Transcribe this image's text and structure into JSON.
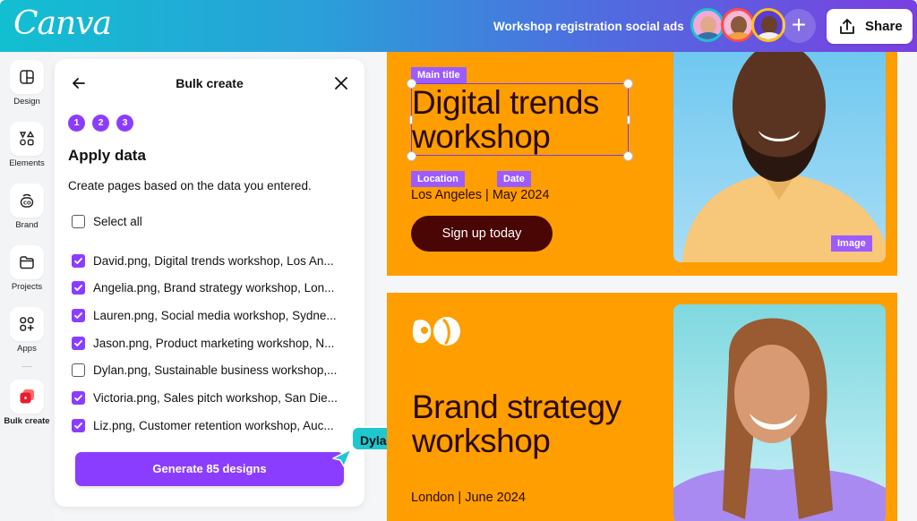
{
  "topbar": {
    "logo": "Canva",
    "doc_title": "Workshop registration social ads",
    "collaborators": [
      {
        "name": "collaborator-1",
        "ring": "#19c2d6",
        "bg": "#f3a9d8",
        "face": "#e1a88a",
        "body": "#3a6ea5"
      },
      {
        "name": "collaborator-2",
        "ring": "#ff4b4b",
        "bg": "#f7b9d5",
        "face": "#8a5a3c",
        "body": "#f0a040"
      },
      {
        "name": "collaborator-3",
        "ring": "#ffc21a",
        "bg": "#5b3bd6",
        "face": "#6a4128",
        "body": "#f4efe8"
      }
    ],
    "add_label": "+",
    "share_label": "Share"
  },
  "sidebar": {
    "items": [
      {
        "label": "Design",
        "icon": "layout-icon"
      },
      {
        "label": "Elements",
        "icon": "shapes-icon"
      },
      {
        "label": "Brand",
        "icon": "brand-icon"
      },
      {
        "label": "Projects",
        "icon": "folder-icon"
      },
      {
        "label": "Apps",
        "icon": "apps-icon"
      },
      {
        "label": "Bulk create",
        "icon": "bulk-create-icon"
      }
    ]
  },
  "panel": {
    "title": "Bulk create",
    "steps": [
      "1",
      "2",
      "3"
    ],
    "heading": "Apply data",
    "description": "Create pages based on the data you entered.",
    "select_all_label": "Select all",
    "select_all_checked": false,
    "rows": [
      {
        "label": "David.png, Digital trends workshop, Los An...",
        "checked": true
      },
      {
        "label": "Angelia.png, Brand strategy workshop, Lon...",
        "checked": true
      },
      {
        "label": "Lauren.png, Social media workshop, Sydne...",
        "checked": true
      },
      {
        "label": "Jason.png, Product marketing workshop, N...",
        "checked": true
      },
      {
        "label": "Dylan.png, Sustainable business workshop,...",
        "checked": false
      },
      {
        "label": "Victoria.png, Sales pitch workshop, San Die...",
        "checked": true
      },
      {
        "label": "Liz.png, Customer retention workshop, Auc...",
        "checked": true
      }
    ],
    "generate_label": "Generate 85 designs"
  },
  "cursor": {
    "name": "Dylan",
    "color": "#1fc7cf"
  },
  "canvas": {
    "card1": {
      "tag_main_title": "Main title",
      "title_line1": "Digital trends",
      "title_line2": "workshop",
      "tag_location": "Location",
      "tag_date": "Date",
      "subline": "Los Angeles | May 2024",
      "cta": "Sign up today",
      "tag_image": "Image"
    },
    "card2": {
      "title_line1": "Brand strategy",
      "title_line2": "workshop",
      "subline": "London | June 2024"
    },
    "colors": {
      "card_bg": "#ff9e00",
      "tag_bg": "#9c5cff",
      "accent": "#8b3dff"
    }
  }
}
